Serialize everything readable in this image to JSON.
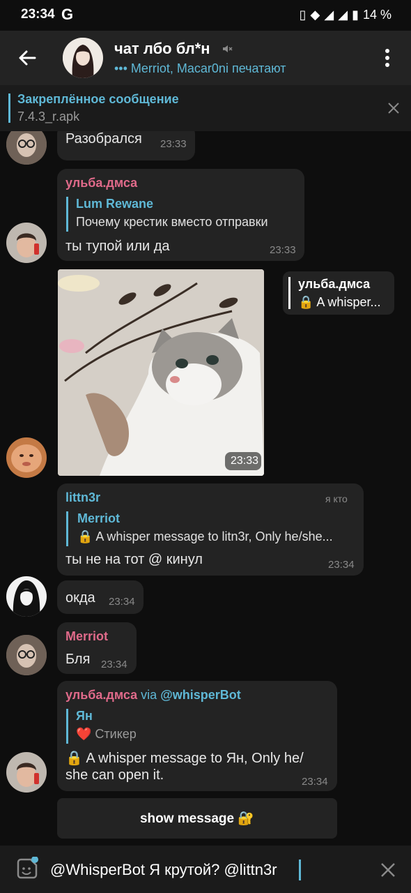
{
  "status_bar": {
    "time": "23:34",
    "carrier_icon": "G",
    "battery": "14 %"
  },
  "header": {
    "title": "чат лбо бл*н",
    "typing": "••• Merriot, Macar0ni печатают"
  },
  "pinned": {
    "title": "Закреплённое сообщение",
    "text": "7.4.3_r.apk"
  },
  "messages": [
    {
      "text": "Разобрался",
      "time": "23:33"
    },
    {
      "sender": "ульба.дмса",
      "reply_name": "Lum Rewane",
      "reply_text": "Почему крестик вместо отправки",
      "text": "ты тупой или да",
      "time": "23:33"
    },
    {
      "image_time": "23:33",
      "side_reply_name": "ульба.дмса",
      "side_reply_text": "🔒 A whisper..."
    },
    {
      "sender": "littn3r",
      "tag": "я кто",
      "reply_name": "Merriot",
      "reply_text": "🔒 A whisper message to litn3r, Only he/she...",
      "text": "ты не на тот @ кинул",
      "time": "23:34"
    },
    {
      "text": "окда",
      "time": "23:34"
    },
    {
      "sender": "Merriot",
      "text": "Бля",
      "time": "23:34"
    },
    {
      "sender": "ульба.дмса",
      "via": "via",
      "bot": "@whisperBot",
      "reply_name": "Ян",
      "reply_text": "❤️ Стикер",
      "text_line1": "🔒 A whisper message to Ян, Only he/",
      "text_line2": "she can open it.",
      "time": "23:34",
      "button": "show message 🔐"
    }
  ],
  "input": {
    "value": "@WhisperBot Я крутой? @littn3r"
  }
}
